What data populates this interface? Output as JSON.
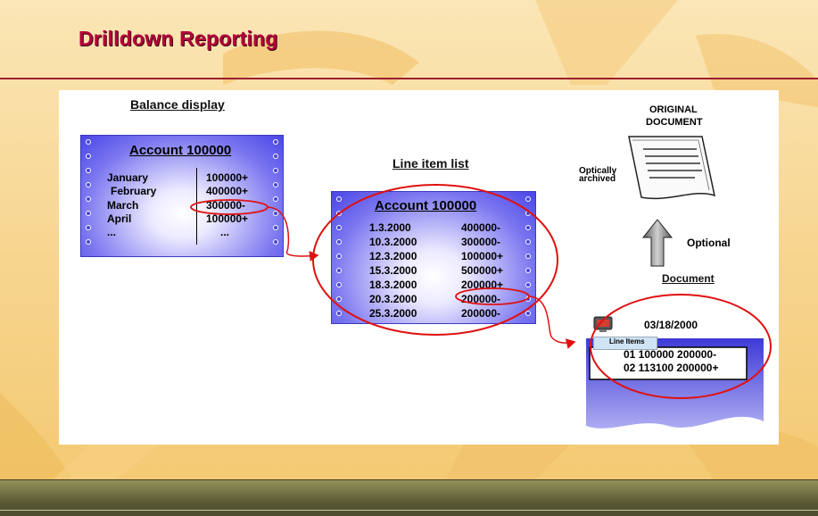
{
  "slide": {
    "title": "Drilldown Reporting",
    "colors": {
      "title": "#b3003b",
      "rule": "#9b1f2f",
      "card_fill": "#4a45e6",
      "highlight": "#e01010"
    }
  },
  "balance_display": {
    "heading": "Balance display",
    "account_title": "Account 100000",
    "months": [
      "January",
      "February",
      "March",
      "April",
      "..."
    ],
    "values": [
      "100000+",
      "400000+",
      "300000-",
      "100000+",
      "..."
    ],
    "highlighted_row": "March"
  },
  "line_item_list": {
    "heading": "Line item list",
    "account_title": "Account 100000",
    "rows": [
      {
        "date": "1.3.2000",
        "amount": "400000-"
      },
      {
        "date": "10.3.2000",
        "amount": "300000-"
      },
      {
        "date": "12.3.2000",
        "amount": "100000+"
      },
      {
        "date": "15.3.2000",
        "amount": "500000+"
      },
      {
        "date": "18.3.2000",
        "amount": "200000+"
      },
      {
        "date": "20.3.2000",
        "amount": "200000-"
      },
      {
        "date": "25.3.2000",
        "amount": "200000-"
      }
    ],
    "highlighted_row": "20.3.2000"
  },
  "original_document": {
    "label_line1": "ORIGINAL",
    "label_line2": "DOCUMENT",
    "archived_line1": "Optically",
    "archived_line2": "archived",
    "arrow_label": "Optional",
    "icon": "paper-document-icon"
  },
  "document": {
    "heading": "Document",
    "date": "03/18/2000",
    "tab_label": "Line Items",
    "lines": [
      "01  100000 200000-",
      "02  113100 200000+"
    ],
    "icon": "computer-monitor-icon"
  }
}
